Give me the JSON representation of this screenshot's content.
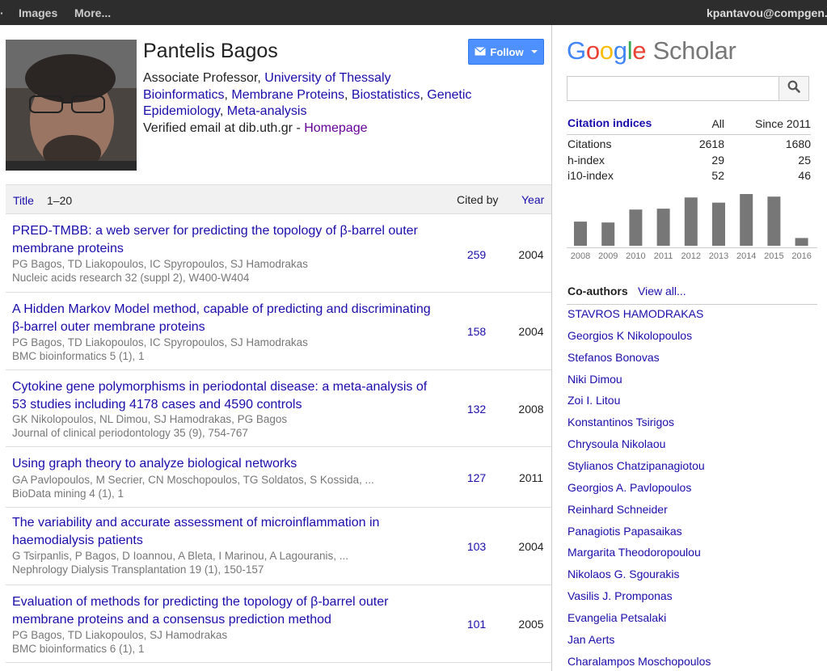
{
  "topbar": {
    "dot": "·",
    "images": "Images",
    "more": "More...",
    "email": "kpantavou@compgen."
  },
  "profile": {
    "name": "Pantelis Bagos",
    "follow": "Follow",
    "position": "Associate Professor, ",
    "affiliation": "University of Thessaly",
    "interests": [
      "Bioinformatics",
      "Membrane Proteins",
      "Biostatistics",
      "Genetic Epidemiology",
      "Meta-analysis"
    ],
    "interest_sep": ", ",
    "verified": "Verified email at dib.uth.gr - ",
    "homepage": "Homepage"
  },
  "table": {
    "title_col": "Title",
    "range": "1–20",
    "cited_col": "Cited by",
    "year_col": "Year"
  },
  "publications": [
    {
      "title": "PRED-TMBB: a web server for predicting the topology of β-barrel outer membrane proteins",
      "authors": "PG Bagos, TD Liakopoulos, IC Spyropoulos, SJ Hamodrakas",
      "venue": "Nucleic acids research 32 (suppl 2), W400-W404",
      "cited": "259",
      "year": "2004"
    },
    {
      "title": "A Hidden Markov Model method, capable of predicting and discriminating β-barrel outer membrane proteins",
      "authors": "PG Bagos, TD Liakopoulos, IC Spyropoulos, SJ Hamodrakas",
      "venue": "BMC bioinformatics 5 (1), 1",
      "cited": "158",
      "year": "2004"
    },
    {
      "title": "Cytokine gene polymorphisms in periodontal disease: a meta-analysis of 53 studies including 4178 cases and 4590 controls",
      "authors": "GK Nikolopoulos, NL Dimou, SJ Hamodrakas, PG Bagos",
      "venue": "Journal of clinical periodontology 35 (9), 754-767",
      "cited": "132",
      "year": "2008"
    },
    {
      "title": "Using graph theory to analyze biological networks",
      "authors": "GA Pavlopoulos, M Secrier, CN Moschopoulos, TG Soldatos, S Kossida, ...",
      "venue": "BioData mining 4 (1), 1",
      "cited": "127",
      "year": "2011"
    },
    {
      "title": "The variability and accurate assessment of microinflammation in haemodialysis patients",
      "authors": "G Tsirpanlis, P Bagos, D Ioannou, A Bleta, I Marinou, A Lagouranis, ...",
      "venue": "Nephrology Dialysis Transplantation 19 (1), 150-157",
      "cited": "103",
      "year": "2004"
    },
    {
      "title": "Evaluation of methods for predicting the topology of β-barrel outer membrane proteins and a consensus prediction method",
      "authors": "PG Bagos, TD Liakopoulos, SJ Hamodrakas",
      "venue": "BMC bioinformatics 6 (1), 1",
      "cited": "101",
      "year": "2005"
    }
  ],
  "logo": {
    "letters": [
      "G",
      "o",
      "o",
      "g",
      "l",
      "e"
    ],
    "colors": [
      "#4285f4",
      "#ea4335",
      "#fbbc05",
      "#4285f4",
      "#34a853",
      "#ea4335"
    ],
    "scholar": "Scholar",
    "scholar_color": "#777777"
  },
  "search": {
    "placeholder": "",
    "icon": "search-icon"
  },
  "citations": {
    "label": "Citation indices",
    "all_col": "All",
    "since_col": "Since 2011",
    "rows": [
      {
        "label": "Citations",
        "all": "2618",
        "since": "1680"
      },
      {
        "label": "h-index",
        "all": "29",
        "since": "25"
      },
      {
        "label": "i10-index",
        "all": "52",
        "since": "46"
      }
    ]
  },
  "chart_data": {
    "type": "bar",
    "categories": [
      "2008",
      "2009",
      "2010",
      "2011",
      "2012",
      "2013",
      "2014",
      "2015",
      "2016"
    ],
    "values": [
      140,
      135,
      210,
      215,
      280,
      250,
      300,
      285,
      45
    ],
    "ylim": [
      0,
      300
    ],
    "color": "#777777",
    "grid": false
  },
  "coauthors": {
    "label": "Co-authors",
    "view_all": "View all...",
    "names": [
      "STAVROS HAMODRAKAS",
      "Georgios K Nikolopoulos",
      "Stefanos Bonovas",
      "Niki Dimou",
      "Zoi I. Litou",
      "Konstantinos Tsirigos",
      "Chrysoula Nikolaou",
      "Stylianos Chatzipanagiotou",
      "Georgios A. Pavlopoulos",
      "Reinhard Schneider",
      "Panagiotis Papasaikas",
      "Margarita Theodoropoulou",
      "Nikolaos G. Sgourakis",
      "Vasilis J. Promponas",
      "Evangelia Petsalaki",
      "Jan Aerts",
      "Charalampos Moschopoulos"
    ],
    "visited": [
      false,
      false,
      true,
      false,
      false,
      false,
      false,
      false,
      false,
      false,
      false,
      false,
      false,
      false,
      false,
      false,
      false
    ]
  }
}
